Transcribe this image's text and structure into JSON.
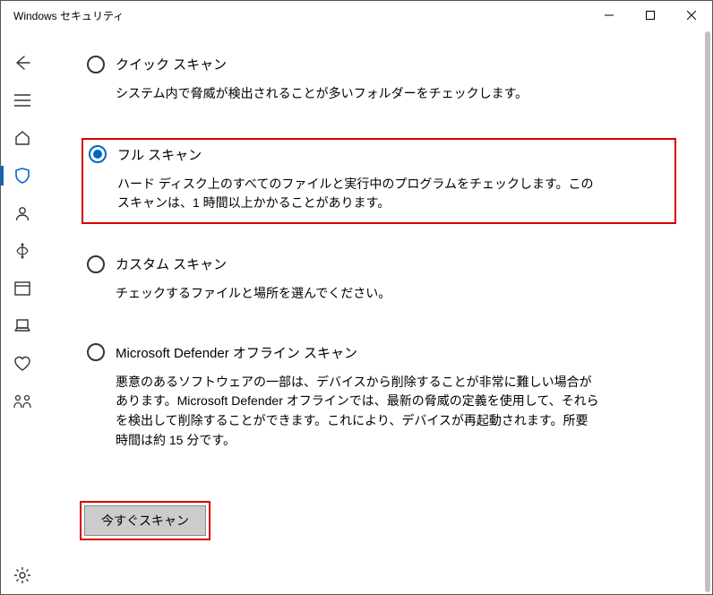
{
  "window": {
    "title": "Windows セキュリティ"
  },
  "options": {
    "quick": {
      "label": "クイック スキャン",
      "desc": "システム内で脅威が検出されることが多いフォルダーをチェックします。"
    },
    "full": {
      "label": "フル スキャン",
      "desc": "ハード ディスク上のすべてのファイルと実行中のプログラムをチェックします。このスキャンは、1 時間以上かかることがあります。"
    },
    "custom": {
      "label": "カスタム スキャン",
      "desc": "チェックするファイルと場所を選んでください。"
    },
    "offline": {
      "label": "Microsoft Defender オフライン スキャン",
      "desc": "悪意のあるソフトウェアの一部は、デバイスから削除することが非常に難しい場合があります。Microsoft Defender オフラインでは、最新の脅威の定義を使用して、それらを検出して削除することができます。これにより、デバイスが再起動されます。所要時間は約 15 分です。"
    }
  },
  "buttons": {
    "scan_now": "今すぐスキャン"
  },
  "selected_option": "full"
}
